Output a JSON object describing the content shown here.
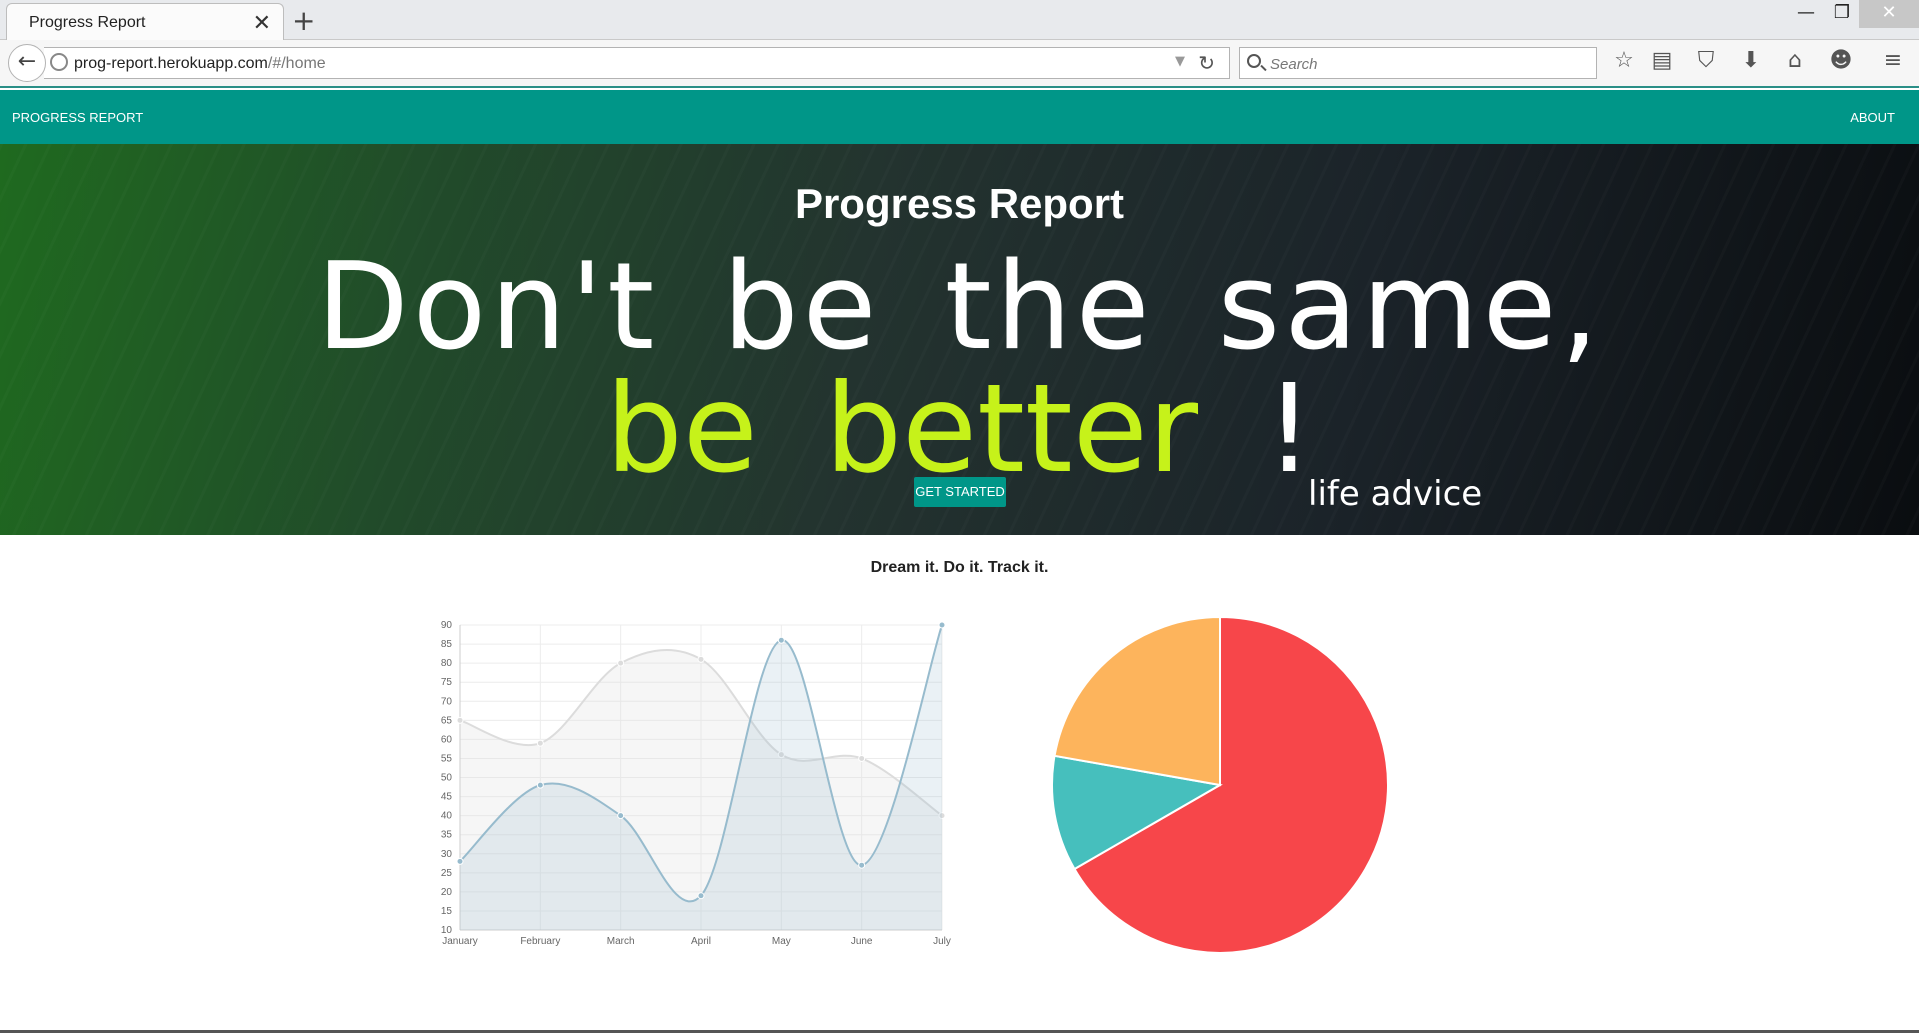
{
  "browser": {
    "tab_title": "Progress Report",
    "url_host": "prog-report.herokuapp.com",
    "url_path": "/#/home",
    "search_placeholder": "Search"
  },
  "nav": {
    "brand": "PROGRESS REPORT",
    "about": "ABOUT"
  },
  "hero": {
    "title": "Progress Report",
    "line1": "Don't be the same,",
    "line2": "be better",
    "bang": "!",
    "cta": "GET STARTED",
    "advice": "life advice"
  },
  "tagline": "Dream it. Do it. Track it.",
  "colors": {
    "accent": "#009688",
    "highlight": "#c6f21a",
    "pie_red": "#f7464a",
    "pie_teal": "#46bfbd",
    "pie_orange": "#fdb45c"
  },
  "chart_data": [
    {
      "type": "line",
      "categories": [
        "January",
        "February",
        "March",
        "April",
        "May",
        "June",
        "July"
      ],
      "series": [
        {
          "values": [
            65,
            59,
            80,
            81,
            56,
            55,
            40
          ],
          "color": "#dcdcdc"
        },
        {
          "values": [
            28,
            48,
            40,
            19,
            86,
            27,
            90
          ],
          "color": "#97bbcd"
        }
      ],
      "ylim": [
        10,
        90
      ],
      "yticks": [
        10,
        15,
        20,
        25,
        30,
        35,
        40,
        45,
        50,
        55,
        60,
        65,
        70,
        75,
        80,
        85,
        90
      ],
      "grid": true,
      "fill": true
    },
    {
      "type": "pie",
      "values": [
        300,
        50,
        100
      ],
      "colors": [
        "#f7464a",
        "#46bfbd",
        "#fdb45c"
      ]
    }
  ]
}
